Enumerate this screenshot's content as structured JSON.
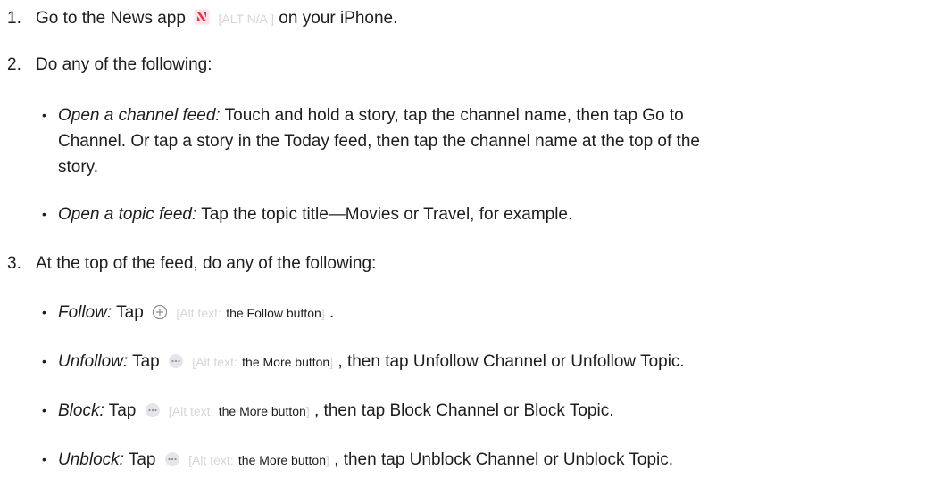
{
  "steps": [
    {
      "number": "1.",
      "before": "Go to the News app",
      "alt": "[ALT N/A ]",
      "after": "on your iPhone."
    },
    {
      "number": "2.",
      "text": "Do any of the following:",
      "items": [
        {
          "label": "Open a channel feed:",
          "line1": "Touch and hold a story, tap the channel name, then tap Go to",
          "line2": "Channel. Or tap a story in the Today feed, then tap the channel name at the top of the",
          "line3": "story."
        },
        {
          "label": "Open a topic feed:",
          "text": "Tap the topic title—Movies or Travel, for example."
        }
      ]
    },
    {
      "number": "3.",
      "text": "At the top of the feed, do any of the following:",
      "items": [
        {
          "label": "Follow:",
          "tap": "Tap",
          "alt_prefix": "[Alt text:",
          "alt_text": "the Follow button",
          "alt_close": "]",
          "after": "."
        },
        {
          "label": "Unfollow:",
          "tap": "Tap",
          "alt_prefix": "[Alt text:",
          "alt_text": "the More button",
          "alt_close": "]",
          "after": ", then tap Unfollow Channel or Unfollow Topic."
        },
        {
          "label": "Block:",
          "tap": "Tap",
          "alt_prefix": "[Alt text:",
          "alt_text": "the More button",
          "alt_close": "]",
          "after": ", then tap Block Channel or Block Topic."
        },
        {
          "label": "Unblock:",
          "tap": "Tap",
          "alt_prefix": "[Alt text:",
          "alt_text": "the More button",
          "alt_close": "]",
          "after": ", then tap Unblock Channel or Unblock Topic."
        }
      ]
    }
  ],
  "bullet_char": "•",
  "colors": {
    "text": "#1d1d1f",
    "alt_faint": "#d6d6d6",
    "news_red": "#fa2c44",
    "icon_gray": "#8e8e93"
  }
}
